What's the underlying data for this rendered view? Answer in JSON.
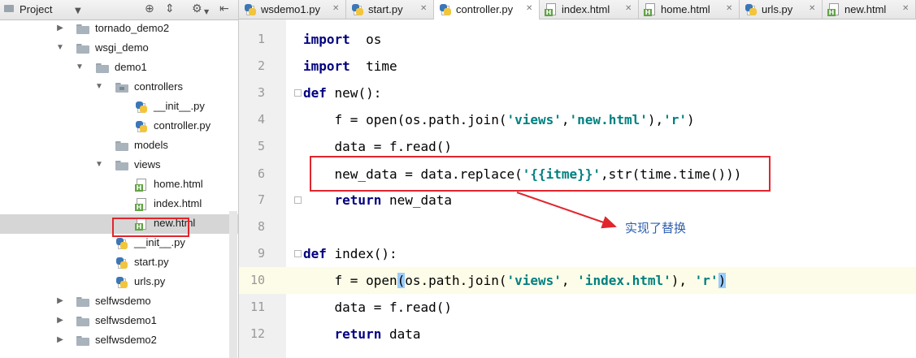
{
  "project_panel": {
    "title": "Project",
    "tree": [
      {
        "label": "tornado_demo2",
        "kind": "folder",
        "state": "collapsed",
        "depth": 0
      },
      {
        "label": "wsgi_demo",
        "kind": "folder",
        "state": "expanded",
        "depth": 0
      },
      {
        "label": "demo1",
        "kind": "folder",
        "state": "expanded",
        "depth": 1
      },
      {
        "label": "controllers",
        "kind": "package",
        "state": "expanded",
        "depth": 2
      },
      {
        "label": "__init__.py",
        "kind": "py",
        "depth": 3
      },
      {
        "label": "controller.py",
        "kind": "py",
        "depth": 3
      },
      {
        "label": "models",
        "kind": "folder",
        "depth": 2
      },
      {
        "label": "views",
        "kind": "folder",
        "state": "expanded",
        "depth": 2
      },
      {
        "label": "home.html",
        "kind": "html",
        "depth": 3
      },
      {
        "label": "index.html",
        "kind": "html",
        "depth": 3
      },
      {
        "label": "new.html",
        "kind": "html",
        "depth": 3,
        "selected": true
      },
      {
        "label": "__init__.py",
        "kind": "py",
        "depth": 2
      },
      {
        "label": "start.py",
        "kind": "py",
        "depth": 2
      },
      {
        "label": "urls.py",
        "kind": "py",
        "depth": 2
      },
      {
        "label": "selfwsdemo",
        "kind": "folder",
        "state": "collapsed",
        "depth": 0
      },
      {
        "label": "selfwsdemo1",
        "kind": "folder",
        "state": "collapsed",
        "depth": 0
      },
      {
        "label": "selfwsdemo2",
        "kind": "folder",
        "state": "collapsed",
        "depth": 0
      }
    ]
  },
  "tabs": [
    {
      "label": "wsdemo1.py",
      "kind": "py",
      "active": false
    },
    {
      "label": "start.py",
      "kind": "py",
      "active": false
    },
    {
      "label": "controller.py",
      "kind": "py",
      "active": true
    },
    {
      "label": "index.html",
      "kind": "html",
      "active": false
    },
    {
      "label": "home.html",
      "kind": "html",
      "active": false
    },
    {
      "label": "urls.py",
      "kind": "py",
      "active": false
    },
    {
      "label": "new.html",
      "kind": "html",
      "active": false
    }
  ],
  "editor": {
    "current_line": 10,
    "lines": [
      {
        "num": "1",
        "tokens": [
          [
            "kw",
            "import"
          ],
          [
            "",
            "  os"
          ]
        ]
      },
      {
        "num": "2",
        "tokens": [
          [
            "kw",
            "import"
          ],
          [
            "",
            "  time"
          ]
        ]
      },
      {
        "num": "3",
        "tokens": [
          [
            "kw",
            "def"
          ],
          [
            "",
            " new():"
          ]
        ]
      },
      {
        "num": "4",
        "tokens": [
          [
            "",
            "    f = open(os.path.join("
          ],
          [
            "str",
            "'views'"
          ],
          [
            "",
            ","
          ],
          [
            "str",
            "'new.html'"
          ],
          [
            "",
            "),"
          ],
          [
            "str",
            "'r'"
          ],
          [
            "",
            ")"
          ]
        ]
      },
      {
        "num": "5",
        "tokens": [
          [
            "",
            "    data = f.read()"
          ]
        ]
      },
      {
        "num": "6",
        "tokens": [
          [
            "",
            "    new_data = data.replace("
          ],
          [
            "str",
            "'{{itme}}'"
          ],
          [
            "",
            ",str(time.time()))"
          ]
        ]
      },
      {
        "num": "7",
        "tokens": [
          [
            "",
            "    "
          ],
          [
            "kw",
            "return"
          ],
          [
            "",
            " new_data"
          ]
        ]
      },
      {
        "num": "8",
        "tokens": []
      },
      {
        "num": "9",
        "tokens": [
          [
            "kw",
            "def"
          ],
          [
            "",
            " index():"
          ]
        ]
      },
      {
        "num": "10",
        "tokens": [
          [
            "",
            "    f = open"
          ],
          [
            "bh",
            "("
          ],
          [
            "",
            "os.path.join("
          ],
          [
            "str",
            "'views'"
          ],
          [
            "",
            ", "
          ],
          [
            "str",
            "'index.html'"
          ],
          [
            "",
            "), "
          ],
          [
            "str",
            "'r'"
          ],
          [
            "bh",
            ")"
          ]
        ]
      },
      {
        "num": "11",
        "tokens": [
          [
            "",
            "    data = f.read()"
          ]
        ]
      },
      {
        "num": "12",
        "tokens": [
          [
            "",
            "    "
          ],
          [
            "kw",
            "return"
          ],
          [
            "",
            " data"
          ]
        ]
      }
    ]
  },
  "annotation": {
    "text": "实现了替换",
    "color": "#e0262d"
  }
}
